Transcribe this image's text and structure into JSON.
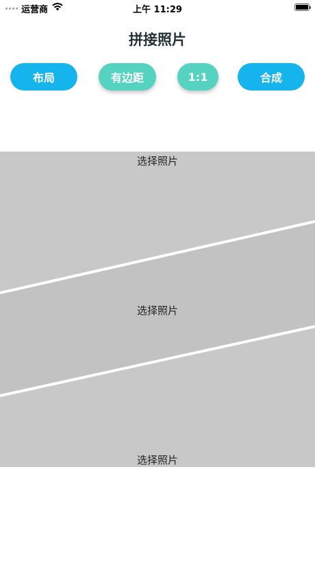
{
  "status_bar": {
    "carrier": "运营商",
    "time": "上午 11:29",
    "icons": [
      "signal-dots-icon",
      "wifi-icon",
      "battery-icon"
    ]
  },
  "page": {
    "title": "拼接照片"
  },
  "toolbar": {
    "layout_label": "布局",
    "spacing_label": "有边距",
    "ratio_label": "1:1",
    "compose_label": "合成",
    "colors": {
      "blue": "#16b4ec",
      "teal": "#56d2c0"
    }
  },
  "collage": {
    "slots": [
      {
        "label": "选择照片"
      },
      {
        "label": "选择照片"
      },
      {
        "label": "选择照片"
      }
    ],
    "colors": {
      "slot_1": "#c8c8c8",
      "slot_2": "#c2c2c2",
      "slot_3": "#c8c8c8",
      "divider": "#ffffff"
    }
  }
}
